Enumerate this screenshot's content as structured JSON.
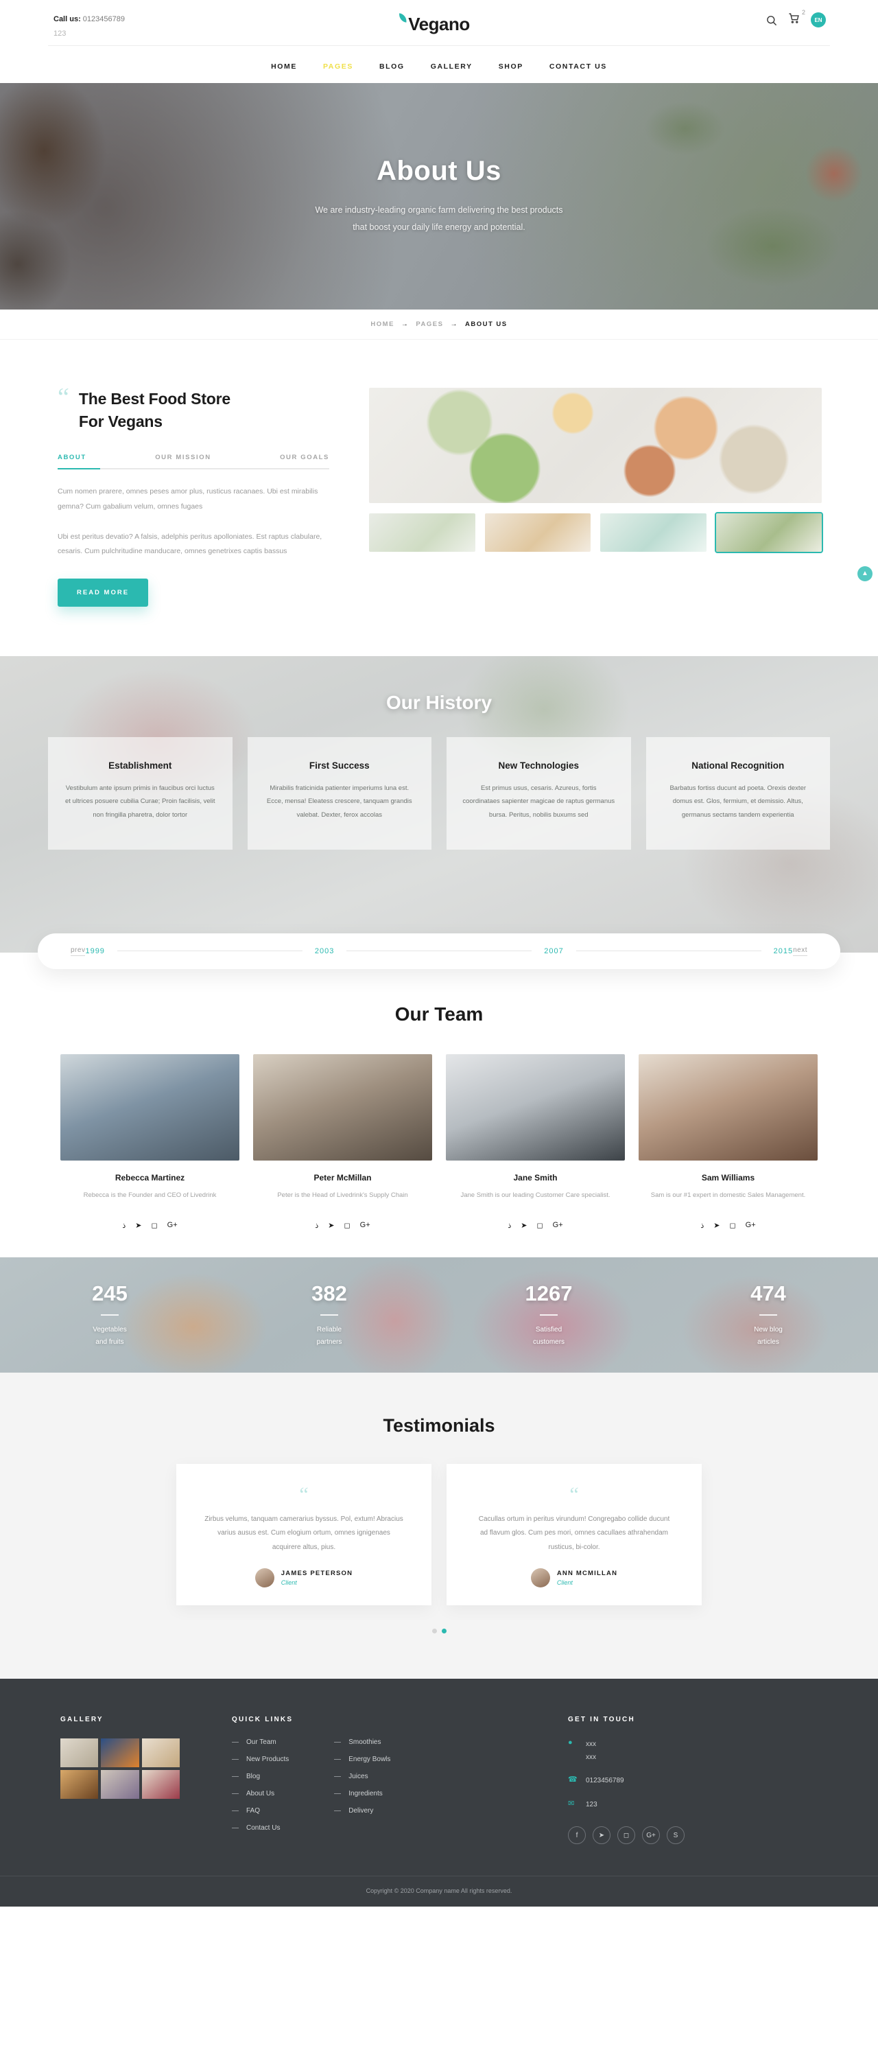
{
  "topbar": {
    "call_label": "Call us:",
    "phone": "0123456789",
    "sub": "123",
    "logo": "Vegano",
    "cart_count": "2",
    "lang": "EN",
    "search_icon": "search-icon",
    "cart_icon": "cart-icon"
  },
  "nav": [
    {
      "label": "HOME",
      "active": false
    },
    {
      "label": "PAGES",
      "active": true
    },
    {
      "label": "BLOG",
      "active": false
    },
    {
      "label": "GALLERY",
      "active": false
    },
    {
      "label": "SHOP",
      "active": false
    },
    {
      "label": "CONTACT US",
      "active": false
    }
  ],
  "hero": {
    "title": "About Us",
    "subtitle_line1": "We are industry-leading organic farm delivering the best products",
    "subtitle_line2": "that boost your daily life energy and potential."
  },
  "breadcrumb": {
    "home": "HOME",
    "pages": "PAGES",
    "current": "ABOUT US",
    "separator": "→"
  },
  "about": {
    "title_line1": "The Best Food Store",
    "title_line2": "For Vegans",
    "tabs": [
      "ABOUT",
      "OUR MISSION",
      "OUR GOALS"
    ],
    "active_tab": "ABOUT",
    "para1": "Cum nomen prarere, omnes peses amor plus, rusticus racanaes. Ubi est mirabilis gemna? Cum gabalium velum, omnes fugaes",
    "para2": "Ubi est peritus devatio? A falsis, adelphis peritus apolloniates. Est raptus clabulare, cesaris. Cum pulchritudine manducare, omnes genetrixes captis bassus",
    "button": "READ MORE"
  },
  "history": {
    "title": "Our History",
    "cards": [
      {
        "title": "Establishment",
        "text": "Vestibulum ante ipsum primis in faucibus orci luctus et ultrices posuere cubilia Curae; Proin facilisis, velit non fringilla pharetra, dolor tortor"
      },
      {
        "title": "First Success",
        "text": "Mirabilis fraticinida patienter imperiums luna est. Ecce, mensa! Eleatess crescere, tanquam grandis valebat. Dexter, ferox accolas"
      },
      {
        "title": "New Technologies",
        "text": "Est primus usus, cesaris. Azureus, fortis coordinataes sapienter magicae de raptus germanus bursa. Peritus, nobilis buxums sed"
      },
      {
        "title": "National Recognition",
        "text": "Barbatus fortiss ducunt ad poeta. Orexis dexter domus est. Glos, fermium, et demissio. Altus, germanus sectams tandem experientia"
      }
    ],
    "prev": "prev",
    "next": "next",
    "years": [
      "1999",
      "2003",
      "2007",
      "2015"
    ]
  },
  "team": {
    "title": "Our Team",
    "members": [
      {
        "name": "Rebecca Martinez",
        "desc": "Rebecca is the Founder and CEO of Livedrink"
      },
      {
        "name": "Peter McMillan",
        "desc": "Peter is the Head of Livedrink's Supply Chain"
      },
      {
        "name": "Jane Smith",
        "desc": "Jane Smith is our leading Customer Care specialist."
      },
      {
        "name": "Sam Williams",
        "desc": "Sam is our #1 expert in domestic Sales Management."
      }
    ],
    "social_icons": [
      "facebook-icon",
      "twitter-icon",
      "instagram-icon",
      "google-plus-icon"
    ]
  },
  "stats": [
    {
      "number": "245",
      "label_line1": "Vegetables",
      "label_line2": "and fruits"
    },
    {
      "number": "382",
      "label_line1": "Reliable",
      "label_line2": "partners"
    },
    {
      "number": "1267",
      "label_line1": "Satisfied",
      "label_line2": "customers"
    },
    {
      "number": "474",
      "label_line1": "New blog",
      "label_line2": "articles"
    }
  ],
  "testimonials": {
    "title": "Testimonials",
    "items": [
      {
        "text": "Zirbus velums, tanquam camerarius byssus. Pol, extum! Abracius varius ausus est. Cum elogium ortum, omnes ignigenaes acquirere altus, pius.",
        "name": "JAMES PETERSON",
        "role": "Client"
      },
      {
        "text": "Cacullas ortum in peritus virundum! Congregabo collide ducunt ad flavum glos. Cum pes mori, omnes cacullaes athrahendam rusticus, bi-color.",
        "name": "ANN MCMILLAN",
        "role": "Client"
      }
    ],
    "active_dot": 1
  },
  "footer": {
    "gallery_heading": "GALLERY",
    "quick_links_heading": "QUICK LINKS",
    "get_in_touch_heading": "GET IN TOUCH",
    "links_col1": [
      "Our Team",
      "New Products",
      "Blog",
      "About Us",
      "FAQ",
      "Contact Us"
    ],
    "links_col2": [
      "Smoothies",
      "Energy Bowls",
      "Juices",
      "Ingredients",
      "Delivery"
    ],
    "address_line1": "xxx",
    "address_line2": "xxx",
    "phone": "0123456789",
    "email": "123",
    "socials": [
      "facebook-icon",
      "twitter-icon",
      "instagram-icon",
      "google-plus-icon",
      "skype-icon"
    ],
    "copyright": "Copyright © 2020 Company name All rights reserved."
  },
  "colors": {
    "accent": "#2bb9b0",
    "nav_active": "#f0e04b",
    "footer_bg": "#3a3e42"
  }
}
